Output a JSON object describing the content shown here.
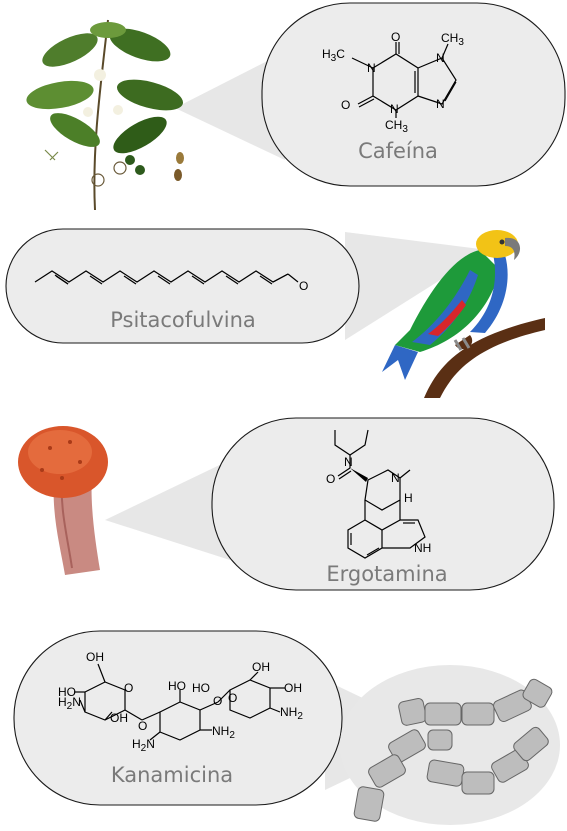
{
  "panels": [
    {
      "label": "Cafeína",
      "source": "coffee-plant-illustration",
      "molecule_atoms": {
        "me1": "CH",
        "me1_sub": "3",
        "me1_prefix": "H",
        "me1_prefix_sub": "3",
        "me1_suffix": "C",
        "o1": "O",
        "o2": "O",
        "n1": "N",
        "n2": "N",
        "n3": "N",
        "n4": "N",
        "me2": "CH",
        "me2_sub": "3",
        "me3": "CH",
        "me3_sub": "3"
      }
    },
    {
      "label": "Psitacofulvina",
      "source": "parrot-illustration",
      "molecule_atoms": {
        "o": "O"
      }
    },
    {
      "label": "Ergotamina",
      "source": "ergot-fungus-illustration",
      "molecule_atoms": {
        "o": "O",
        "n1": "N",
        "n2": "N",
        "h": "H",
        "nh": "NH"
      }
    },
    {
      "label": "Kanamicina",
      "source": "bacteria-illustration",
      "molecule_atoms": {
        "oh1": "OH",
        "oh2": "OH",
        "oh3": "OH",
        "oh4": "OH",
        "oh5": "OH",
        "ho1": "HO",
        "ho2": "HO",
        "ho3": "HO",
        "h2n1": "H",
        "h2n1_sub": "2",
        "h2n1_suffix": "N",
        "h2n2": "H",
        "h2n2_sub": "2",
        "h2n2_suffix": "N",
        "nh2a": "NH",
        "nh2a_sub": "2",
        "nh2b": "NH",
        "nh2b_sub": "2",
        "o1": "O",
        "o2": "O",
        "o3": "O",
        "o4": "O"
      }
    }
  ],
  "colors": {
    "bubble_fill": "#ececec",
    "bubble_stroke": "#1a1a1a",
    "label_gray": "#7a7a7a",
    "parrot_green": "#1e9a3a",
    "parrot_blue": "#2f67c4",
    "parrot_yellow": "#f2c316",
    "parrot_red": "#d8262b",
    "branch_brown": "#5a2f14",
    "fungus_orange": "#d9562b",
    "fungus_stem": "#c98a82",
    "bacteria_gray": "#bdbdbd"
  }
}
